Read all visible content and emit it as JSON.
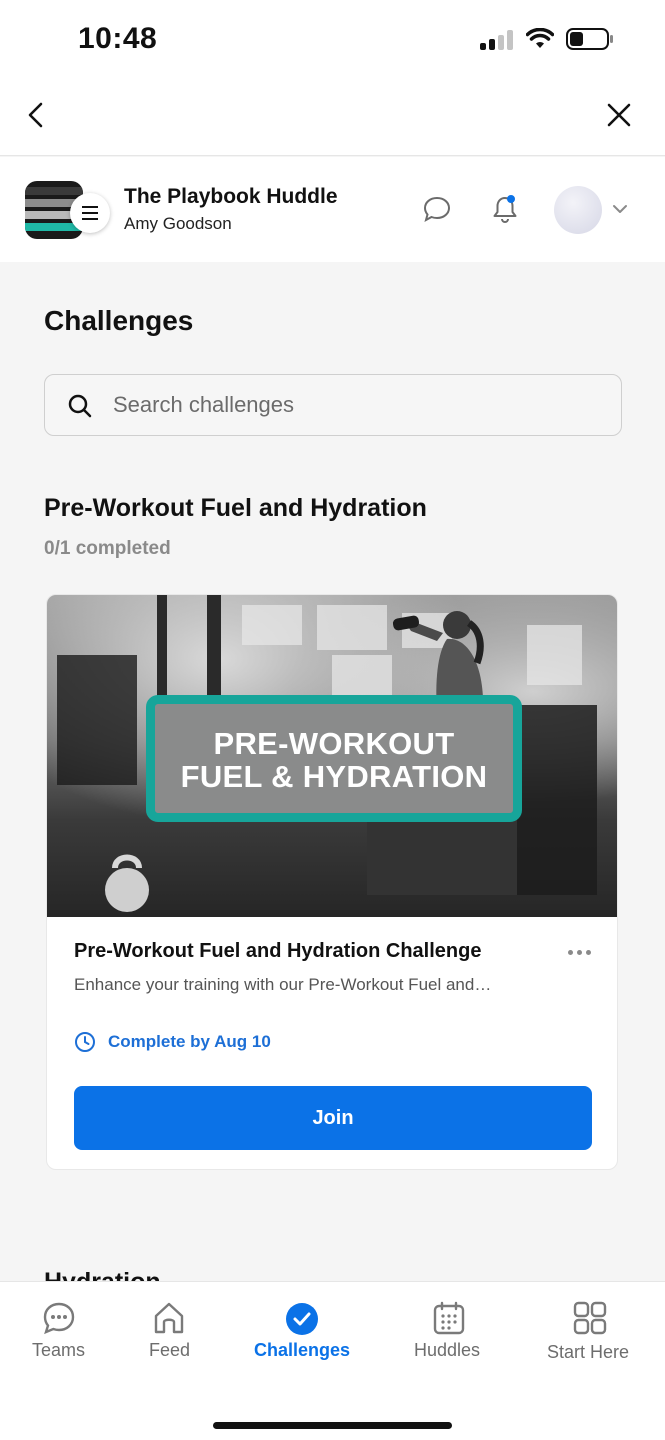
{
  "status_bar": {
    "time": "10:48"
  },
  "header": {
    "title": "The Playbook Huddle",
    "subtitle": "Amy Goodson"
  },
  "page": {
    "title": "Challenges",
    "search": {
      "placeholder": "Search challenges",
      "value": ""
    }
  },
  "section": {
    "title": "Pre-Workout Fuel and Hydration",
    "progress": "0/1 completed"
  },
  "card": {
    "banner_line1": "PRE-WORKOUT",
    "banner_line2": "FUEL & HYDRATION",
    "title": "Pre-Workout Fuel and Hydration Challenge",
    "description": "Enhance your training with our Pre-Workout Fuel and…",
    "due": "Complete by Aug 10",
    "button": "Join"
  },
  "next_section": {
    "title": "Hydration"
  },
  "tabs": [
    {
      "label": "Teams",
      "icon": "chat-bubble-icon",
      "active": false
    },
    {
      "label": "Feed",
      "icon": "home-icon",
      "active": false
    },
    {
      "label": "Challenges",
      "icon": "check-circle-icon",
      "active": true
    },
    {
      "label": "Huddles",
      "icon": "calendar-icon",
      "active": false
    },
    {
      "label": "Start Here",
      "icon": "grid-icon",
      "active": false
    }
  ],
  "colors": {
    "accent": "#0b72e7",
    "teal": "#17a59a",
    "due_text": "#1d6fd6"
  }
}
